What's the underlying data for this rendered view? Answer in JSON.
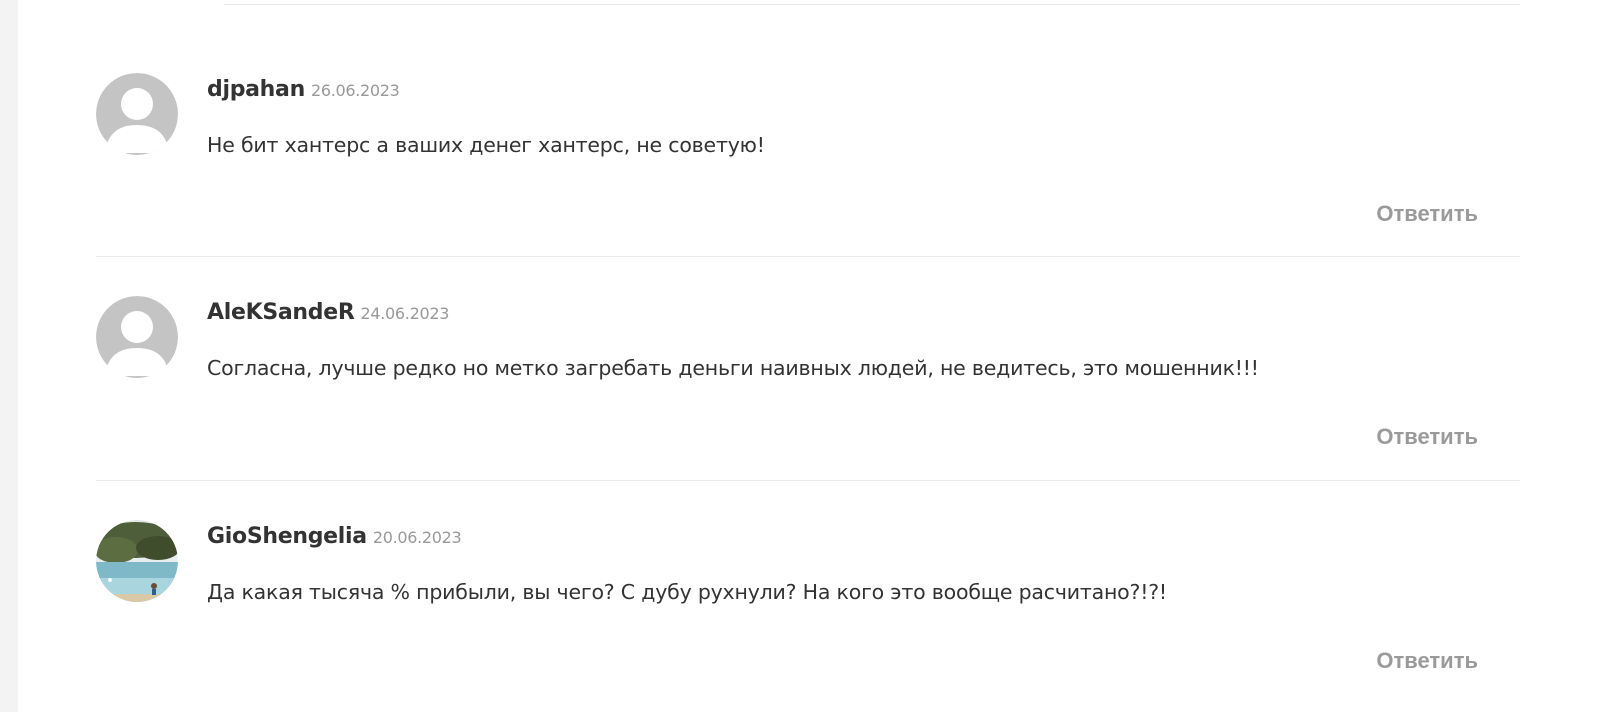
{
  "comments": [
    {
      "author": "djpahan",
      "date": "26.06.2023",
      "text": "Не бит хантерс а ваших денег хантерс, не советую!",
      "reply_label": "Ответить",
      "avatar_icon": "default-user-icon"
    },
    {
      "author": "AleKSandeR",
      "date": "24.06.2023",
      "text": "Согласна, лучше редко но метко загребать деньги наивных людей, не ведитесь, это мошенник!!!",
      "reply_label": "Ответить",
      "avatar_icon": "default-user-icon"
    },
    {
      "author": "GioShengelia",
      "date": "20.06.2023",
      "text": "Да какая тысяча % прибыли, вы чего? С дубу рухнули? На кого это вообще расчитано?!?!",
      "reply_label": "Ответить",
      "avatar_icon": "photo-avatar"
    }
  ],
  "colors": {
    "author": "#333333",
    "date": "#999999",
    "reply": "#9a9a9a",
    "avatar_placeholder": "#c4c4c4",
    "divider": "#ebebeb"
  }
}
